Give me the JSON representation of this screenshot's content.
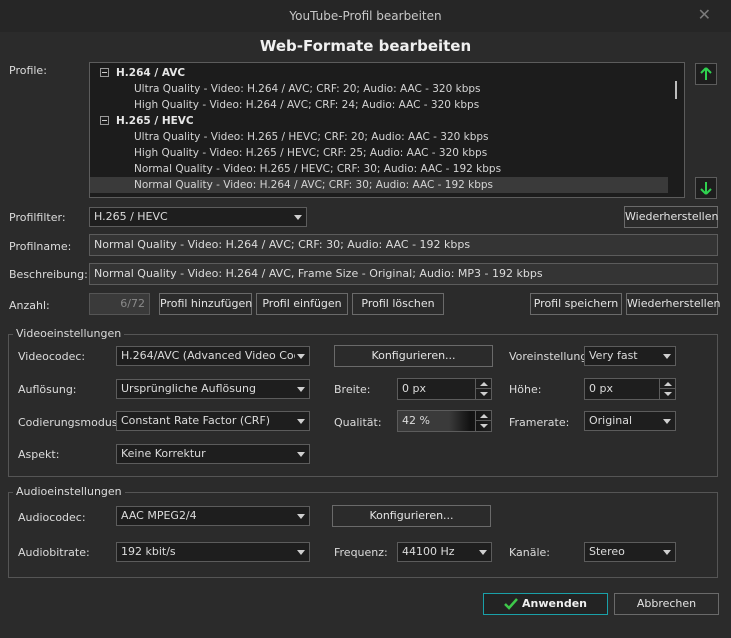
{
  "window": {
    "title": "YouTube-Profil bearbeiten",
    "close_glyph": "✕"
  },
  "heading": "Web-Formate bearbeiten",
  "profiles": {
    "label": "Profile:",
    "rows": [
      {
        "type": "group",
        "text": "H.264 / AVC"
      },
      {
        "type": "item",
        "text": "Ultra Quality - Video: H.264 / AVC; CRF: 20; Audio: AAC - 320 kbps"
      },
      {
        "type": "item",
        "text": "High Quality - Video: H.264 / AVC; CRF: 24; Audio: AAC - 320 kbps"
      },
      {
        "type": "group",
        "text": "H.265 / HEVC"
      },
      {
        "type": "item",
        "text": "Ultra Quality - Video: H.265 / HEVC; CRF: 20; Audio: AAC - 320 kbps"
      },
      {
        "type": "item",
        "text": "High Quality - Video: H.265 / HEVC; CRF: 25; Audio: AAC - 320 kbps"
      },
      {
        "type": "item",
        "text": "Normal Quality - Video: H.265 / HEVC; CRF: 30; Audio: AAC - 192 kbps"
      },
      {
        "type": "item",
        "text": "Normal Quality - Video: H.264 / AVC; CRF: 30; Audio: AAC - 192 kbps",
        "selected": true
      }
    ]
  },
  "filter": {
    "label": "Profilfilter:",
    "value": "H.265 / HEVC",
    "reset_label": "Wiederherstellen"
  },
  "name": {
    "label": "Profilname:",
    "value": "Normal Quality - Video: H.264 / AVC; CRF: 30; Audio: AAC - 192 kbps"
  },
  "description": {
    "label": "Beschreibung:",
    "value": "Normal Quality - Video: H.264 / AVC, Frame Size - Original; Audio: MP3 - 192 kbps"
  },
  "count": {
    "label": "Anzahl:",
    "value": "6/72",
    "add_label": "Profil hinzufügen",
    "insert_label": "Profil einfügen",
    "delete_label": "Profil löschen",
    "save_label": "Profil speichern",
    "reset_label": "Wiederherstellen"
  },
  "video": {
    "title": "Videoeinstellungen",
    "codec_label": "Videocodec:",
    "codec_value": "H.264/AVC (Advanced Video Coding)",
    "configure_label": "Konfigurieren...",
    "preset_label": "Voreinstellung:",
    "preset_value": "Very fast",
    "resolution_label": "Auflösung:",
    "resolution_value": "Ursprüngliche Auflösung",
    "width_label": "Breite:",
    "width_value": "0 px",
    "height_label": "Höhe:",
    "height_value": "0 px",
    "mode_label": "Codierungsmodus:",
    "mode_value": "Constant Rate Factor (CRF)",
    "quality_label": "Qualität:",
    "quality_value": "42 %",
    "framerate_label": "Framerate:",
    "framerate_value": "Original",
    "aspect_label": "Aspekt:",
    "aspect_value": "Keine Korrektur"
  },
  "audio": {
    "title": "Audioeinstellungen",
    "codec_label": "Audiocodec:",
    "codec_value": "AAC MPEG2/4",
    "configure_label": "Konfigurieren...",
    "bitrate_label": "Audiobitrate:",
    "bitrate_value": "192 kbit/s",
    "frequency_label": "Frequenz:",
    "frequency_value": "44100 Hz",
    "channels_label": "Kanäle:",
    "channels_value": "Stereo"
  },
  "footer": {
    "apply_label": "Anwenden",
    "cancel_label": "Abbrechen"
  },
  "colors": {
    "accent": "#1aa0a8",
    "arrow_green": "#2fd24f",
    "check_green": "#3ec84a"
  }
}
